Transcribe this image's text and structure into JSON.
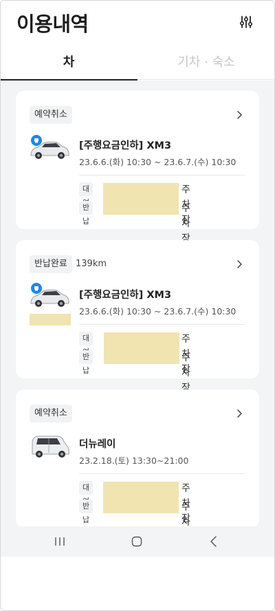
{
  "header": {
    "title": "이용내역",
    "filter_icon": "sliders-icon"
  },
  "tabs": [
    {
      "label": "차",
      "active": true
    },
    {
      "label": "기차 · 숙소",
      "active": false
    }
  ],
  "bookings": [
    {
      "status": "예약취소",
      "distance": "",
      "car_name": "[주행요금인하] XM3",
      "period": "23.6.6.(화) 10:30 ~ 23.6.7.(수) 10:30",
      "has_badge": true,
      "pickup_label": "대여",
      "return_label": "반납",
      "pickup_suffix": "주차장",
      "return_suffix": "주차장"
    },
    {
      "status": "반납완료",
      "distance": "139km",
      "car_name": "[주행요금인하] XM3",
      "period": "23.6.6.(화) 10:30 ~ 23.6.7.(수) 10:30",
      "has_badge": true,
      "pickup_label": "대여",
      "return_label": "반납",
      "pickup_suffix": "주차장",
      "return_suffix": "주차장"
    },
    {
      "status": "예약취소",
      "distance": "",
      "car_name": "더뉴레이",
      "period": "23.2.18.(토) 13:30~21:00",
      "has_badge": false,
      "pickup_label": "대여",
      "return_label": "반납",
      "pickup_suffix": "주차장",
      "return_suffix": "주차장"
    }
  ],
  "navbar": {
    "recent_icon": "recent-apps-icon",
    "home_icon": "home-icon",
    "back_icon": "back-icon"
  },
  "colors": {
    "redaction": "#f0e4b0",
    "badge_blue": "#1e88e5",
    "content_bg": "#f3f4f6"
  }
}
